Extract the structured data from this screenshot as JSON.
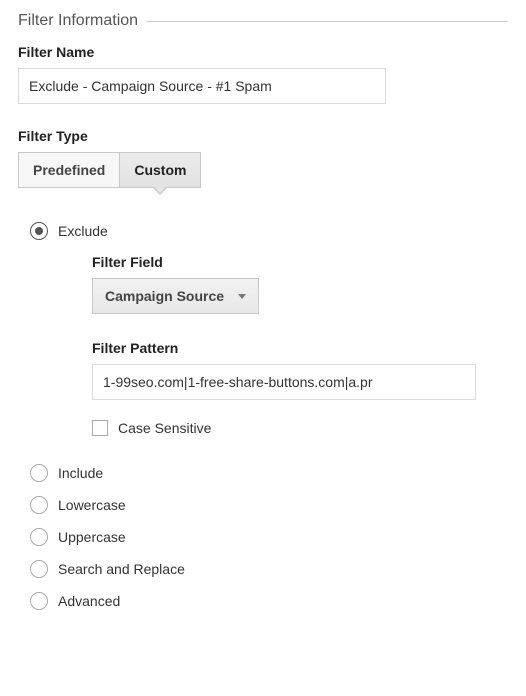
{
  "fieldset": {
    "title": "Filter Information"
  },
  "filterName": {
    "label": "Filter Name",
    "value": "Exclude - Campaign Source - #1 Spam"
  },
  "filterType": {
    "label": "Filter Type",
    "options": {
      "predefined": "Predefined",
      "custom": "Custom"
    },
    "selected": "custom"
  },
  "exclude": {
    "label": "Exclude",
    "filterField": {
      "label": "Filter Field",
      "value": "Campaign Source"
    },
    "filterPattern": {
      "label": "Filter Pattern",
      "value": "1-99seo.com|1-free-share-buttons.com|a.pr"
    },
    "caseSensitive": {
      "label": "Case Sensitive",
      "checked": false
    }
  },
  "otherOptions": {
    "include": "Include",
    "lowercase": "Lowercase",
    "uppercase": "Uppercase",
    "searchReplace": "Search and Replace",
    "advanced": "Advanced"
  }
}
